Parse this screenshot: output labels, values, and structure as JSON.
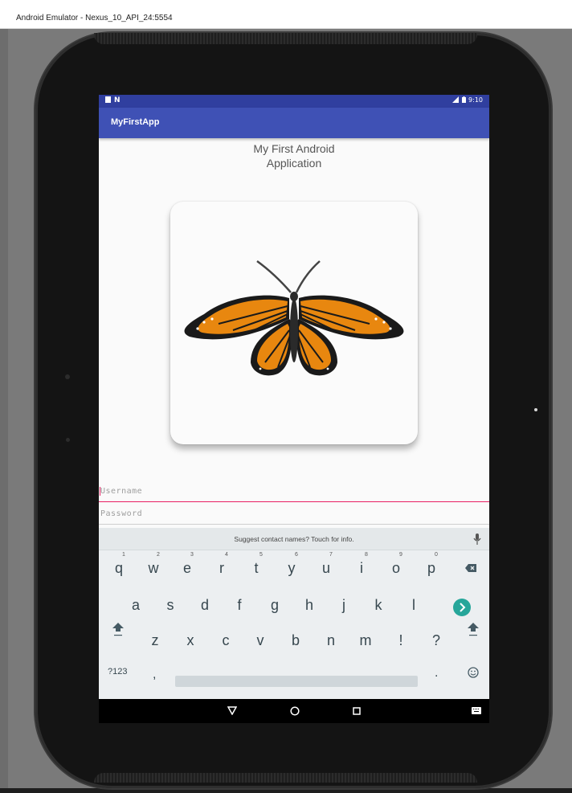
{
  "window": {
    "title": "Android Emulator - Nexus_10_API_24:5554"
  },
  "status_bar": {
    "left_icons": [
      "sim-icon",
      "n-icon"
    ],
    "time": "9:10",
    "right_icons": [
      "signal-icon",
      "battery-icon"
    ]
  },
  "app_bar": {
    "title": "MyFirstApp"
  },
  "main": {
    "heading_line1": "My First Android",
    "heading_line2": "Application",
    "image": "butterfly-image"
  },
  "form": {
    "username_placeholder": "Username",
    "password_placeholder": "Password"
  },
  "keyboard": {
    "suggestion": "Suggest contact names? Touch for info.",
    "row1": [
      {
        "key": "q",
        "hint": "1"
      },
      {
        "key": "w",
        "hint": "2"
      },
      {
        "key": "e",
        "hint": "3"
      },
      {
        "key": "r",
        "hint": "4"
      },
      {
        "key": "t",
        "hint": "5"
      },
      {
        "key": "y",
        "hint": "6"
      },
      {
        "key": "u",
        "hint": "7"
      },
      {
        "key": "i",
        "hint": "8"
      },
      {
        "key": "o",
        "hint": "9"
      },
      {
        "key": "p",
        "hint": "0"
      }
    ],
    "row2": [
      "a",
      "s",
      "d",
      "f",
      "g",
      "h",
      "j",
      "k",
      "l"
    ],
    "row3": [
      "z",
      "x",
      "c",
      "v",
      "b",
      "n",
      "m",
      "!",
      "?"
    ],
    "symbols_label": "?123",
    "comma": ",",
    "period": "."
  },
  "nav_bar": {
    "buttons": [
      "back-icon",
      "home-icon",
      "recents-icon",
      "keyboard-switch-icon"
    ]
  },
  "colors": {
    "status_bar": "#303f9f",
    "app_bar": "#3f51b5",
    "accent": "#e91e63",
    "enter_key": "#26a69a",
    "butterfly_orange": "#e8870f"
  }
}
